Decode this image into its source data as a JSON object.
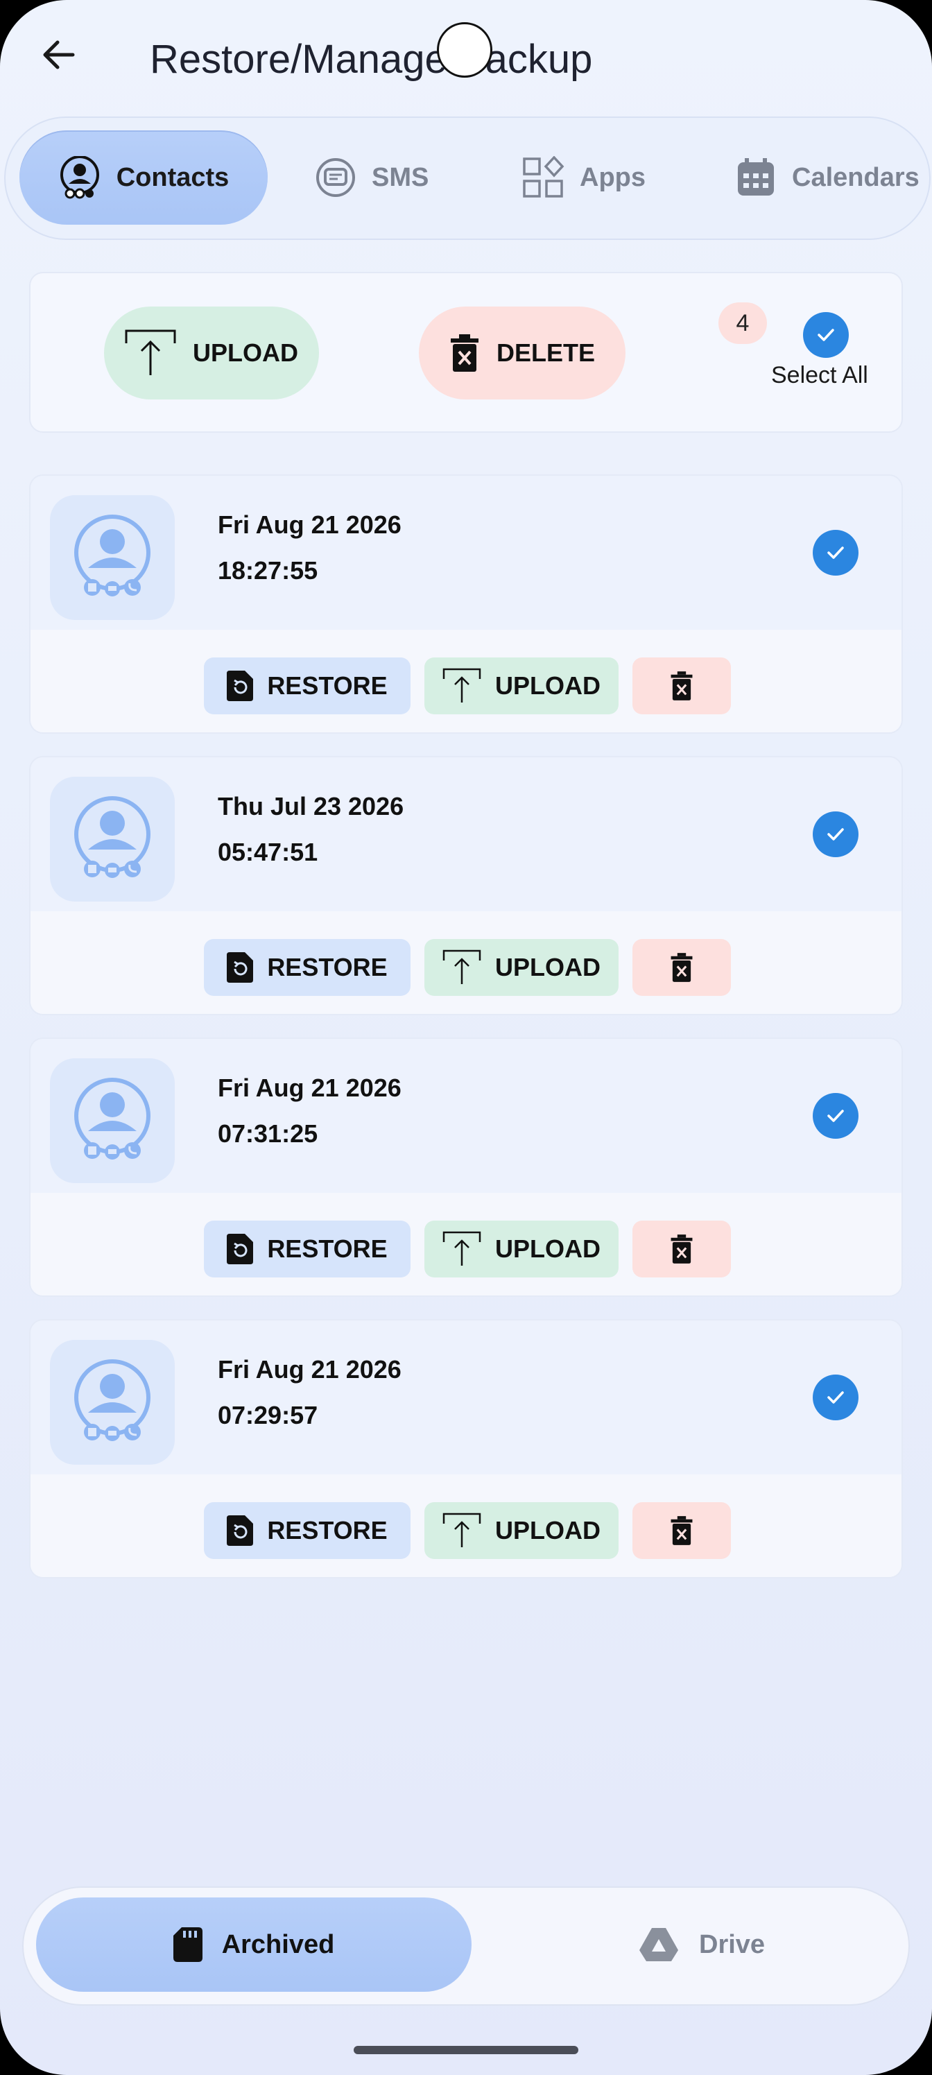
{
  "header": {
    "title": "Restore/Manage Backup"
  },
  "tabs": [
    {
      "label": "Contacts",
      "icon": "contacts-icon",
      "active": true
    },
    {
      "label": "SMS",
      "icon": "sms-icon",
      "active": false
    },
    {
      "label": "Apps",
      "icon": "apps-icon",
      "active": false
    },
    {
      "label": "Calendars",
      "icon": "calendar-icon",
      "active": false
    }
  ],
  "actions": {
    "upload_label": "UPLOAD",
    "delete_label": "DELETE",
    "selected_count": "4",
    "select_all_label": "Select All",
    "select_all_checked": true
  },
  "backups": [
    {
      "date": "Fri Aug 21 2026",
      "time": "18:27:55",
      "checked": true
    },
    {
      "date": "Thu Jul 23 2026",
      "time": "05:47:51",
      "checked": true
    },
    {
      "date": "Fri Aug 21 2026",
      "time": "07:31:25",
      "checked": true
    },
    {
      "date": "Fri Aug 21 2026",
      "time": "07:29:57",
      "checked": true
    }
  ],
  "backup_buttons": {
    "restore_label": "RESTORE",
    "upload_label": "UPLOAD"
  },
  "bottom_nav": [
    {
      "label": "Archived",
      "icon": "sd-card-icon",
      "active": true
    },
    {
      "label": "Drive",
      "icon": "drive-icon",
      "active": false
    }
  ],
  "colors": {
    "accent_blue": "#2b86e0",
    "active_tab": "#b1cbf8",
    "upload_bg": "#d6efe3",
    "delete_bg": "#fde0de",
    "restore_bg": "#d6e4fb"
  }
}
